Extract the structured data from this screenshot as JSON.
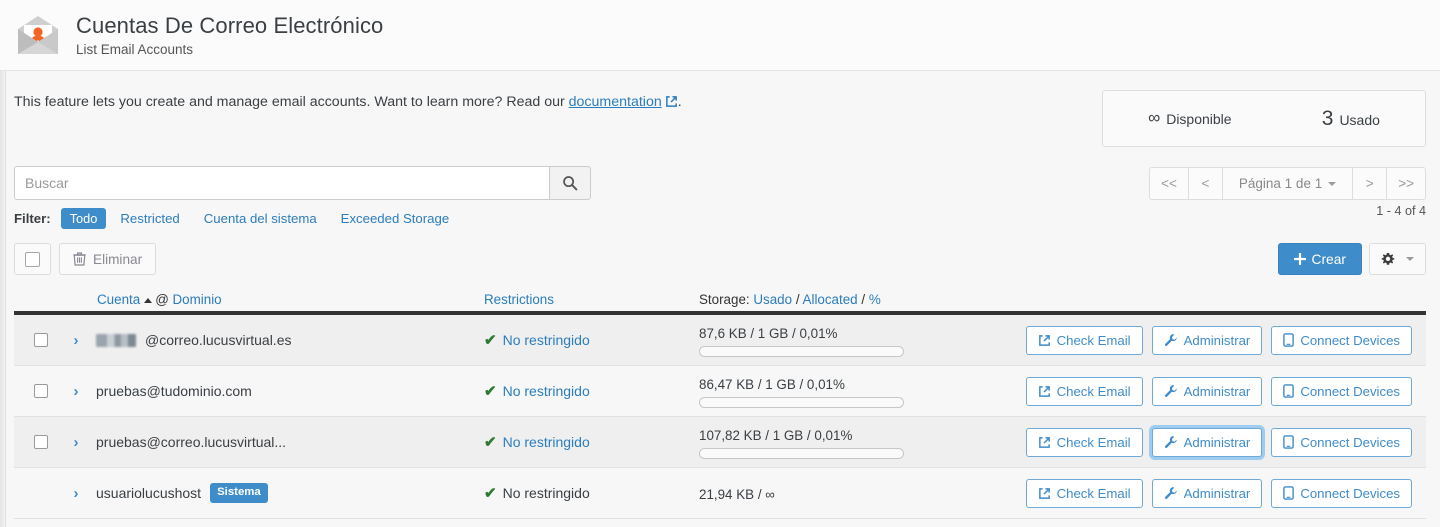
{
  "header": {
    "title": "Cuentas De Correo Electrónico",
    "subtitle": "List Email Accounts",
    "icon": "envelope-user-icon"
  },
  "intro": {
    "text_before": "This feature lets you create and manage email accounts. Want to learn more? Read our ",
    "link_label": "documentation",
    "text_after": "."
  },
  "stats": {
    "available_value": "∞",
    "available_label": "Disponible",
    "used_value": "3",
    "used_label": "Usado"
  },
  "search": {
    "placeholder": "Buscar",
    "value": "",
    "button_icon": "search-icon"
  },
  "filter": {
    "label": "Filter:",
    "options": [
      {
        "label": "Todo",
        "active": true
      },
      {
        "label": "Restricted",
        "active": false
      },
      {
        "label": "Cuenta del sistema",
        "active": false
      },
      {
        "label": "Exceeded Storage",
        "active": false
      }
    ]
  },
  "pager": {
    "first": "<<",
    "prev": "<",
    "page_label": "Página 1 de 1",
    "next": ">",
    "last": ">>",
    "count": "1 - 4 of 4"
  },
  "toolbar": {
    "select_all_icon": "checkbox-icon",
    "delete_label": "Eliminar",
    "delete_icon": "trash-icon",
    "create_label": "Crear",
    "create_icon": "plus-icon",
    "gear_icon": "gear-icon"
  },
  "table": {
    "columns": {
      "account_sort": "Cuenta",
      "account_at": "@",
      "account_domain": "Dominio",
      "restrictions": "Restrictions",
      "storage_label": "Storage:",
      "storage_used": "Usado",
      "storage_sep1": "/",
      "storage_allocated": "Allocated",
      "storage_sep2": "/",
      "storage_percent": "%"
    },
    "rows": [
      {
        "account": "@correo.lucusvirtual.es",
        "redacted": true,
        "badge": "",
        "has_checkbox": true,
        "restriction": "No restringido",
        "restriction_is_link": true,
        "storage": "87,6 KB / 1 GB / 0,01%",
        "has_progress": true,
        "actions": [
          {
            "label": "Check Email",
            "icon": "external-link-icon",
            "focused": false
          },
          {
            "label": "Administrar",
            "icon": "wrench-icon",
            "focused": false
          },
          {
            "label": "Connect Devices",
            "icon": "mobile-icon",
            "focused": false
          }
        ]
      },
      {
        "account": "pruebas@tudominio.com",
        "redacted": false,
        "badge": "",
        "has_checkbox": true,
        "restriction": "No restringido",
        "restriction_is_link": true,
        "storage": "86,47 KB / 1 GB / 0,01%",
        "has_progress": true,
        "actions": [
          {
            "label": "Check Email",
            "icon": "external-link-icon",
            "focused": false
          },
          {
            "label": "Administrar",
            "icon": "wrench-icon",
            "focused": false
          },
          {
            "label": "Connect Devices",
            "icon": "mobile-icon",
            "focused": false
          }
        ]
      },
      {
        "account": "pruebas@correo.lucusvirtual...",
        "redacted": false,
        "badge": "",
        "has_checkbox": true,
        "restriction": "No restringido",
        "restriction_is_link": true,
        "storage": "107,82 KB / 1 GB / 0,01%",
        "has_progress": true,
        "actions": [
          {
            "label": "Check Email",
            "icon": "external-link-icon",
            "focused": false
          },
          {
            "label": "Administrar",
            "icon": "wrench-icon",
            "focused": true
          },
          {
            "label": "Connect Devices",
            "icon": "mobile-icon",
            "focused": false
          }
        ]
      },
      {
        "account": "usuariolucushost",
        "redacted": false,
        "badge": "Sistema",
        "has_checkbox": false,
        "restriction": "No restringido",
        "restriction_is_link": false,
        "storage": "21,94 KB / ∞",
        "has_progress": false,
        "actions": [
          {
            "label": "Check Email",
            "icon": "external-link-icon",
            "focused": false
          },
          {
            "label": "Administrar",
            "icon": "wrench-icon",
            "focused": false
          },
          {
            "label": "Connect Devices",
            "icon": "mobile-icon",
            "focused": false
          }
        ]
      }
    ]
  },
  "colors": {
    "accent": "#3f8ccb",
    "link": "#2b7dbc",
    "brand_orange": "#f26522",
    "success": "#2f7a34"
  }
}
